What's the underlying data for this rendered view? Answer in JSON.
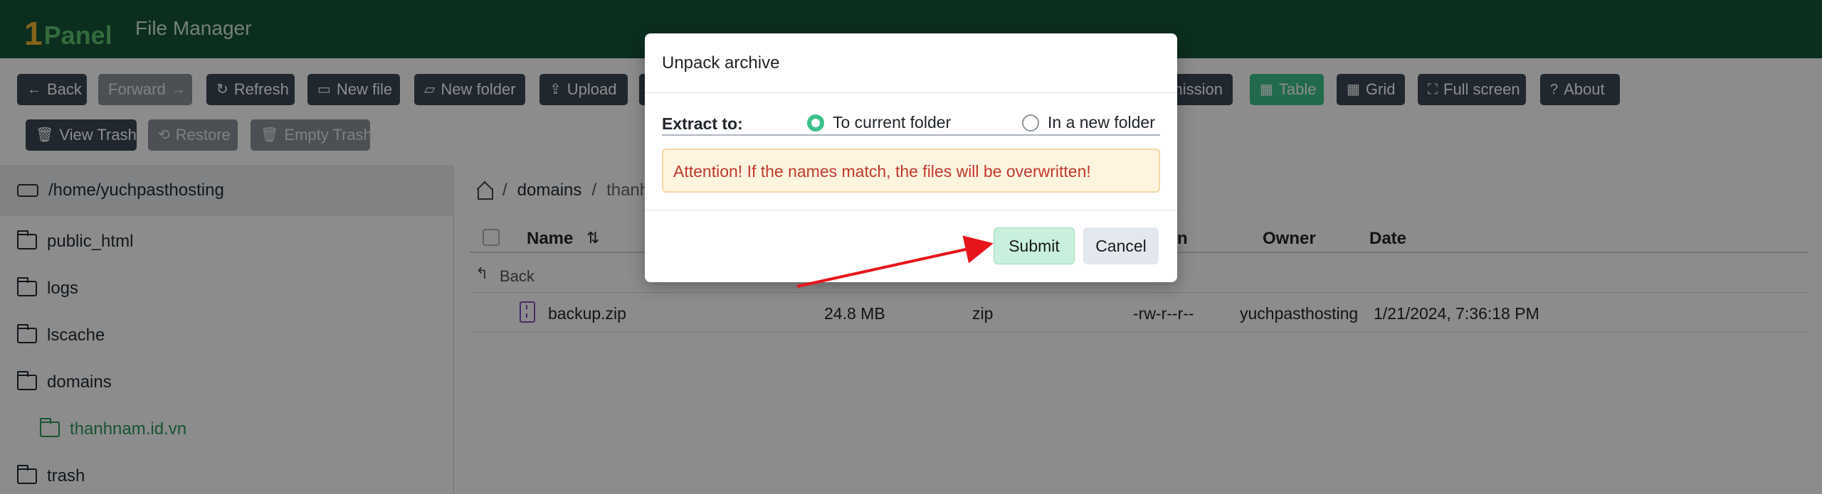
{
  "header": {
    "logo_one": "1",
    "logo_text": "Panel",
    "app_title": "File Manager"
  },
  "toolbar": {
    "row1": [
      {
        "label": "Back",
        "icon": "←",
        "state": "normal"
      },
      {
        "label": "Forward",
        "icon": "→",
        "state": "disabled"
      },
      {
        "label": "Refresh",
        "icon": "↻",
        "state": "normal"
      },
      {
        "label": "New file",
        "icon": "▭",
        "state": "normal"
      },
      {
        "label": "New folder",
        "icon": "▱",
        "state": "normal"
      },
      {
        "label": "Upload",
        "icon": "⇪",
        "state": "normal"
      },
      {
        "label": "mission",
        "icon": "",
        "state": "normal"
      },
      {
        "label": "Table",
        "icon": "▦",
        "state": "active"
      },
      {
        "label": "Grid",
        "icon": "▦",
        "state": "normal"
      },
      {
        "label": "Full screen",
        "icon": "⛶",
        "state": "normal"
      },
      {
        "label": "About",
        "icon": "?",
        "state": "normal"
      }
    ],
    "row2": [
      {
        "label": "View Trash",
        "icon": "🗑",
        "state": "normal"
      },
      {
        "label": "Restore",
        "icon": "⟲",
        "state": "disabled"
      },
      {
        "label": "Empty Trash",
        "icon": "🗑",
        "state": "disabled"
      }
    ]
  },
  "sidebar": {
    "root": "/home/yuchpasthosting",
    "items": [
      {
        "label": "public_html"
      },
      {
        "label": "logs"
      },
      {
        "label": "lscache"
      },
      {
        "label": "domains"
      },
      {
        "label": "thanhnam.id.vn",
        "active": true
      },
      {
        "label": "trash"
      }
    ]
  },
  "breadcrumb": {
    "items": [
      "domains",
      "thanh"
    ]
  },
  "table": {
    "columns": {
      "name": "Name",
      "perm": "n",
      "owner": "Owner",
      "date": "Date"
    },
    "back_label": "Back",
    "rows": [
      {
        "name": "backup.zip",
        "size": "24.8 MB",
        "type": "zip",
        "perms": "-rw-r--r--",
        "owner": "yuchpasthosting",
        "date": "1/21/2024, 7:36:18 PM"
      }
    ]
  },
  "modal": {
    "title": "Unpack archive",
    "extract_label": "Extract to:",
    "option_current": "To current folder",
    "option_new": "In a new folder",
    "selected": "current",
    "warning": "Attention! If the names match, the files will be overwritten!",
    "submit_label": "Submit",
    "cancel_label": "Cancel"
  },
  "colors": {
    "header_bg": "#15543a",
    "accent": "#3cc18a",
    "warning_text": "#c0392b",
    "annotation_arrow": "#e8141c"
  }
}
